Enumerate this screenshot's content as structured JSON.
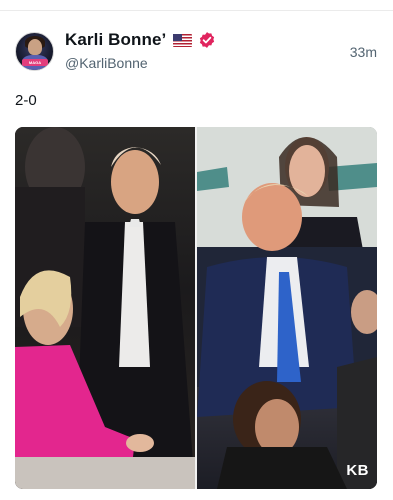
{
  "post": {
    "author": {
      "display_name": "Karli Bonne’",
      "handle": "@KarliBonne",
      "flag_icon": "us-flag-icon",
      "verified_icon": "verified-badge-icon",
      "verified_color": "#e0245e",
      "avatar_text": "MAGA"
    },
    "timestamp": "33m",
    "text": "2-0",
    "media": {
      "left_panel": "photo-handshake-event",
      "right_panel": "photo-seated-event",
      "watermark": "KB"
    }
  }
}
